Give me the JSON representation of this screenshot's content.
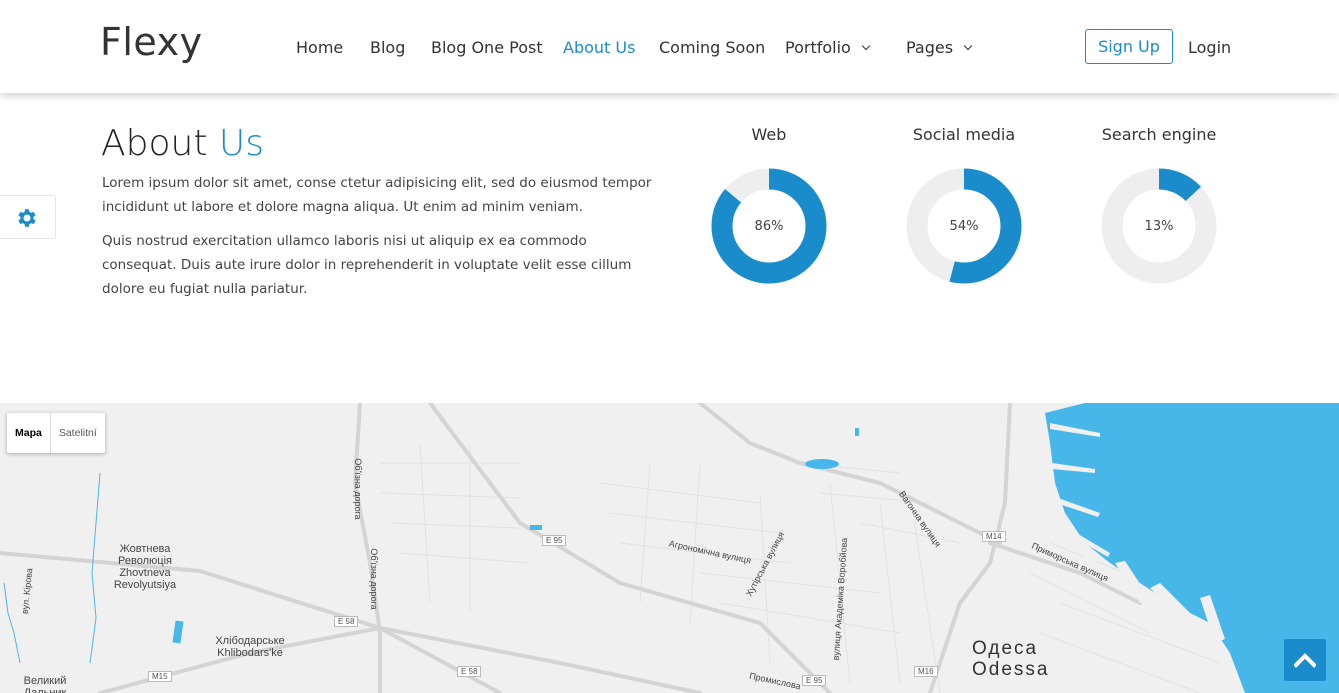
{
  "header": {
    "logo": "Flexy",
    "nav": [
      {
        "label": "Home"
      },
      {
        "label": "Blog"
      },
      {
        "label": "Blog One Post"
      },
      {
        "label": "About Us",
        "active": true
      },
      {
        "label": "Coming Soon"
      },
      {
        "label": "Portfolio",
        "dropdown": true
      },
      {
        "label": "Pages",
        "dropdown": true
      }
    ],
    "signup_label": "Sign Up",
    "login_label": "Login"
  },
  "about": {
    "title_main": "About",
    "title_accent": "Us",
    "paragraph1": "Lorem ipsum dolor sit amet, conse ctetur adipisicing elit, sed do eiusmod tempor incididunt ut labore et dolore magna aliqua. Ut enim ad minim veniam.",
    "paragraph2": "Quis nostrud exercitation ullamco laboris nisi ut aliquip ex ea commodo consequat. Duis aute irure dolor in reprehenderit in voluptate velit esse cillum dolore eu fugiat nulla pariatur."
  },
  "stats": [
    {
      "label": "Web",
      "value": 86,
      "display": "86%"
    },
    {
      "label": "Social media",
      "value": 54,
      "display": "54%"
    },
    {
      "label": "Search engine",
      "value": 13,
      "display": "13%"
    }
  ],
  "map": {
    "types": [
      "Mapa",
      "Satelitní"
    ],
    "labels": {
      "zhovtneva": "Жовтнева Революція Zhovtneva Revolyutsiya",
      "khlibodarske": "Хлібодарське Khlibodars'ke",
      "velykyi": "Великий Дальник",
      "odesa": "Одеса",
      "odessa": "Odessa",
      "agronomichna": "Агрономічна вулиця",
      "khutirska": "Хутірська вулиця",
      "akademika": "вулиця Академіка Воробйова",
      "vokzalna": "Вагонна вулиця",
      "prymorska": "Приморська вулиця",
      "kirova": "вул. Кірова",
      "obizna1": "Об'їзна дорога",
      "obizna2": "Об'їзна дорога",
      "promyslova": "Промислова"
    },
    "roads": [
      "E 95",
      "E 58",
      "E 58",
      "M15",
      "M14",
      "M16",
      "E 95"
    ]
  },
  "colors": {
    "accent": "#1a8ccc",
    "donut_track": "#eeeeee",
    "sea": "#46b7e8"
  },
  "icons": {
    "settings": "gear-icon",
    "to_top": "chevron-up-icon"
  }
}
